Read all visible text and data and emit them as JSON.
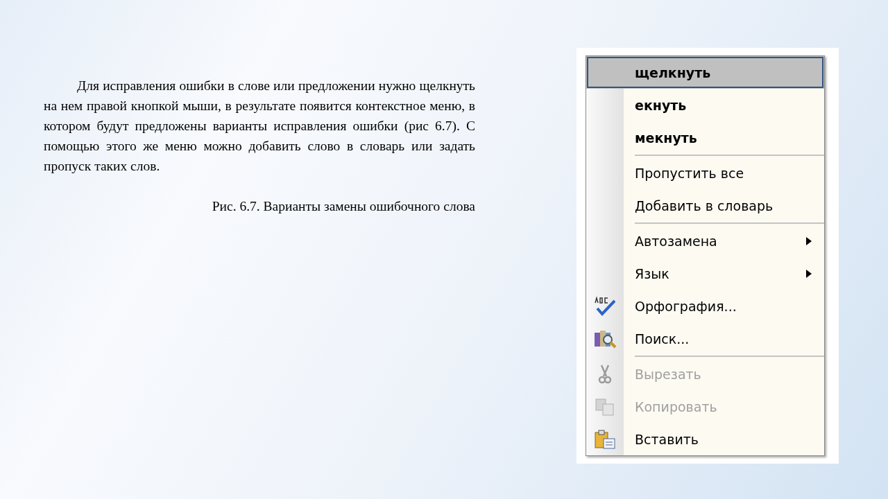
{
  "text": {
    "paragraph": "Для исправления ошибки в слове или предложении нужно щелкнуть на нем правой кнопкой мыши, в результате появится контекстное меню, в котором будут предложены варианты исправления ошибки (рис 6.7). С помощью этого же меню можно добавить слово в словарь или задать пропуск таких слов.",
    "caption": "Рис. 6.7. Варианты замены ошибочного слова"
  },
  "context_menu": {
    "items": [
      {
        "kind": "suggestion",
        "label": "щелкнуть",
        "selected": true
      },
      {
        "kind": "suggestion",
        "label": "екнуть",
        "selected": false
      },
      {
        "kind": "suggestion",
        "label": "мекнуть",
        "selected": false
      },
      {
        "kind": "separator"
      },
      {
        "kind": "command",
        "label": "Пропустить все",
        "selected": false,
        "disabled": false,
        "submenu": false
      },
      {
        "kind": "command",
        "label": "Добавить в словарь",
        "selected": false,
        "disabled": false,
        "submenu": false
      },
      {
        "kind": "separator"
      },
      {
        "kind": "command",
        "label": "Автозамена",
        "selected": false,
        "disabled": false,
        "submenu": true
      },
      {
        "kind": "command",
        "label": "Язык",
        "selected": false,
        "disabled": false,
        "submenu": true
      },
      {
        "kind": "spelling",
        "label": "Орфография...",
        "selected": false,
        "disabled": false,
        "submenu": false
      },
      {
        "kind": "search",
        "label": "Поиск...",
        "selected": false,
        "disabled": false,
        "submenu": false
      },
      {
        "kind": "separator"
      },
      {
        "kind": "cut",
        "label": "Вырезать",
        "selected": false,
        "disabled": true,
        "submenu": false
      },
      {
        "kind": "copy",
        "label": "Копировать",
        "selected": false,
        "disabled": true,
        "submenu": false
      },
      {
        "kind": "paste",
        "label": "Вставить",
        "selected": false,
        "disabled": false,
        "submenu": false
      }
    ]
  }
}
